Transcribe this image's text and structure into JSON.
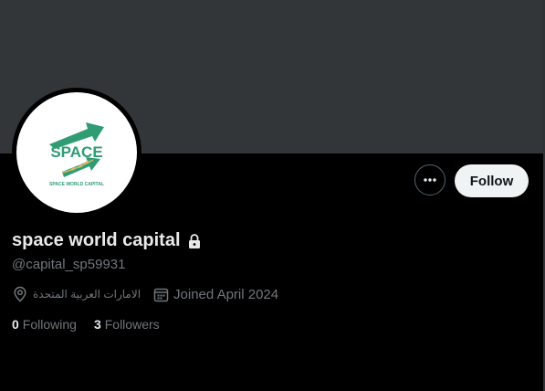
{
  "profile": {
    "display_name": "space world capital",
    "handle": "@capital_sp59931",
    "location": "الامارات العربية المتحدة",
    "joined": "Joined April 2024",
    "protected_icon": "lock-icon"
  },
  "avatar": {
    "logo_text": "SPACE",
    "logo_subtext": "SPACE WORLD CAPITAL"
  },
  "actions": {
    "more_icon": "ellipsis-icon",
    "follow_label": "Follow"
  },
  "stats": {
    "following_count": "0",
    "following_label": "Following",
    "followers_count": "3",
    "followers_label": "Followers"
  },
  "colors": {
    "background": "#000000",
    "banner": "#333639",
    "brand_green": "#2f9c73",
    "muted_text": "#71767b",
    "follow_button_bg": "#eff3f4"
  }
}
